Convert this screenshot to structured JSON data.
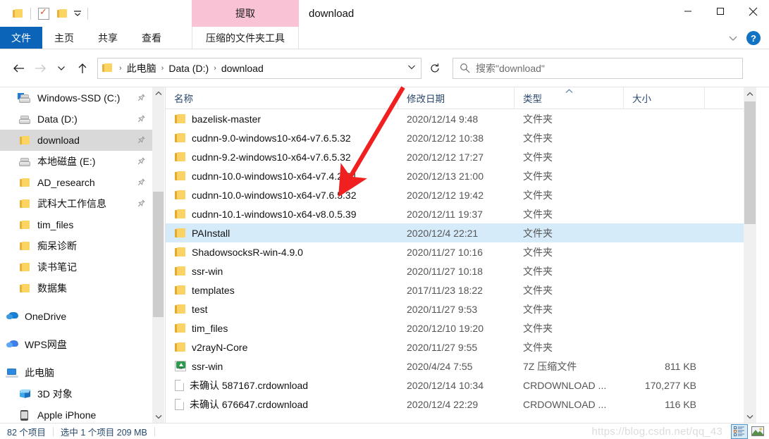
{
  "window": {
    "title": "download",
    "contextual_tab_title": "提取",
    "minimize_label": "—",
    "maximize_label": "▢",
    "close_label": "✕"
  },
  "quick_access": {
    "new_folder_icon": "folder-icon",
    "properties_icon": "properties-icon",
    "new_folder2_icon": "folder-icon",
    "customize_icon": "chevron-down-icon"
  },
  "ribbon": {
    "tabs": [
      {
        "label": "文件",
        "active": true
      },
      {
        "label": "主页",
        "active": false
      },
      {
        "label": "共享",
        "active": false
      },
      {
        "label": "查看",
        "active": false
      }
    ],
    "contextual_tab": "压缩的文件夹工具",
    "collapse_icon": "chevron-down-icon",
    "help_label": "?"
  },
  "toolbar": {
    "back_icon": "arrow-left-icon",
    "forward_icon": "arrow-right-icon",
    "recent_icon": "chevron-down-icon",
    "up_icon": "arrow-up-icon",
    "refresh_icon": "refresh-icon",
    "address_dropdown_icon": "chevron-down-icon"
  },
  "breadcrumb": {
    "folder_icon": "folder-icon",
    "separator": "›",
    "items": [
      "此电脑",
      "Data (D:)",
      "download"
    ]
  },
  "search": {
    "icon": "search-icon",
    "placeholder": "搜索\"download\""
  },
  "sidebar": {
    "items": [
      {
        "label": "Windows-SSD (C:)",
        "icon": "windows-drive-icon",
        "pinned": true,
        "selected": false,
        "indent": 1,
        "gap_before": false
      },
      {
        "label": "Data (D:)",
        "icon": "drive-icon",
        "pinned": true,
        "selected": false,
        "indent": 1,
        "gap_before": false
      },
      {
        "label": "download",
        "icon": "folder-icon",
        "pinned": true,
        "selected": true,
        "indent": 1,
        "gap_before": false
      },
      {
        "label": "本地磁盘 (E:)",
        "icon": "drive-icon",
        "pinned": true,
        "selected": false,
        "indent": 1,
        "gap_before": false
      },
      {
        "label": "AD_research",
        "icon": "folder-icon",
        "pinned": true,
        "selected": false,
        "indent": 1,
        "gap_before": false
      },
      {
        "label": "武科大工作信息",
        "icon": "folder-icon",
        "pinned": true,
        "selected": false,
        "indent": 1,
        "gap_before": false
      },
      {
        "label": "tim_files",
        "icon": "folder-icon",
        "pinned": false,
        "selected": false,
        "indent": 1,
        "gap_before": false
      },
      {
        "label": "痴呆诊断",
        "icon": "folder-icon",
        "pinned": false,
        "selected": false,
        "indent": 1,
        "gap_before": false
      },
      {
        "label": "读书笔记",
        "icon": "folder-icon",
        "pinned": false,
        "selected": false,
        "indent": 1,
        "gap_before": false
      },
      {
        "label": "数据集",
        "icon": "folder-icon",
        "pinned": false,
        "selected": false,
        "indent": 1,
        "gap_before": false
      },
      {
        "label": "OneDrive",
        "icon": "onedrive-icon",
        "pinned": false,
        "selected": false,
        "indent": 0,
        "gap_before": true
      },
      {
        "label": "WPS网盘",
        "icon": "wps-cloud-icon",
        "pinned": false,
        "selected": false,
        "indent": 0,
        "gap_before": true
      },
      {
        "label": "此电脑",
        "icon": "this-pc-icon",
        "pinned": false,
        "selected": false,
        "indent": 0,
        "gap_before": true
      },
      {
        "label": "3D 对象",
        "icon": "3d-objects-icon",
        "pinned": false,
        "selected": false,
        "indent": 1,
        "gap_before": false
      },
      {
        "label": "Apple iPhone",
        "icon": "phone-icon",
        "pinned": false,
        "selected": false,
        "indent": 1,
        "gap_before": false
      }
    ],
    "scroll_up_icon": "chevron-up-icon",
    "scroll_down_icon": "chevron-down-icon"
  },
  "filelist": {
    "columns": [
      {
        "label": "名称",
        "key": "name"
      },
      {
        "label": "修改日期",
        "key": "date"
      },
      {
        "label": "类型",
        "key": "type"
      },
      {
        "label": "大小",
        "key": "size"
      }
    ],
    "sort_indicator": "▲",
    "rows": [
      {
        "name": "bazelisk-master",
        "date": "2020/12/14 9:48",
        "type": "文件夹",
        "size": "",
        "icon": "folder-icon",
        "selected": false
      },
      {
        "name": "cudnn-9.0-windows10-x64-v7.6.5.32",
        "date": "2020/12/12 10:38",
        "type": "文件夹",
        "size": "",
        "icon": "folder-icon",
        "selected": false
      },
      {
        "name": "cudnn-9.2-windows10-x64-v7.6.5.32",
        "date": "2020/12/12 17:27",
        "type": "文件夹",
        "size": "",
        "icon": "folder-icon",
        "selected": false
      },
      {
        "name": "cudnn-10.0-windows10-x64-v7.4.2.24",
        "date": "2020/12/13 21:00",
        "type": "文件夹",
        "size": "",
        "icon": "folder-icon",
        "selected": false
      },
      {
        "name": "cudnn-10.0-windows10-x64-v7.6.5.32",
        "date": "2020/12/12 19:42",
        "type": "文件夹",
        "size": "",
        "icon": "folder-icon",
        "selected": false
      },
      {
        "name": "cudnn-10.1-windows10-x64-v8.0.5.39",
        "date": "2020/12/11 19:37",
        "type": "文件夹",
        "size": "",
        "icon": "folder-icon",
        "selected": false
      },
      {
        "name": "PAInstall",
        "date": "2020/12/4 22:21",
        "type": "文件夹",
        "size": "",
        "icon": "folder-icon",
        "selected": true
      },
      {
        "name": "ShadowsocksR-win-4.9.0",
        "date": "2020/11/27 10:16",
        "type": "文件夹",
        "size": "",
        "icon": "folder-icon",
        "selected": false
      },
      {
        "name": "ssr-win",
        "date": "2020/11/27 10:18",
        "type": "文件夹",
        "size": "",
        "icon": "folder-icon",
        "selected": false
      },
      {
        "name": "templates",
        "date": "2017/11/23 18:22",
        "type": "文件夹",
        "size": "",
        "icon": "folder-icon",
        "selected": false
      },
      {
        "name": "test",
        "date": "2020/11/27 9:53",
        "type": "文件夹",
        "size": "",
        "icon": "folder-icon",
        "selected": false
      },
      {
        "name": "tim_files",
        "date": "2020/12/10 19:20",
        "type": "文件夹",
        "size": "",
        "icon": "folder-icon",
        "selected": false
      },
      {
        "name": "v2rayN-Core",
        "date": "2020/11/27 9:55",
        "type": "文件夹",
        "size": "",
        "icon": "folder-icon",
        "selected": false
      },
      {
        "name": "ssr-win",
        "date": "2020/4/24 7:55",
        "type": "7Z 压缩文件",
        "size": "811 KB",
        "icon": "7z-archive-icon",
        "selected": false
      },
      {
        "name": "未确认 587167.crdownload",
        "date": "2020/12/14 10:34",
        "type": "CRDOWNLOAD ...",
        "size": "170,277 KB",
        "icon": "file-icon",
        "selected": false
      },
      {
        "name": "未确认 676647.crdownload",
        "date": "2020/12/4 22:29",
        "type": "CRDOWNLOAD ...",
        "size": "116 KB",
        "icon": "file-icon",
        "selected": false
      }
    ],
    "scroll_up_icon": "chevron-up-icon",
    "scroll_down_icon": "chevron-down-icon"
  },
  "statusbar": {
    "item_count": "82 个项目",
    "selection": "选中 1 个项目  209 MB",
    "watermark": "https://blog.csdn.net/qq_43",
    "details_view_icon": "details-view-icon",
    "thumbnail_view_icon": "large-icons-view-icon"
  },
  "annotation": {
    "arrow_color": "#f02020",
    "type": "red-arrow",
    "points_to": "cudnn-10.0-windows10-x64-v7.4.2.24"
  },
  "colors": {
    "accent": "#0b64b8",
    "contextual_tab": "#f9c2d5",
    "selection": "#d6ebfa",
    "nav_selection": "#d9d9d9",
    "folder_yellow": "#fbd265"
  }
}
